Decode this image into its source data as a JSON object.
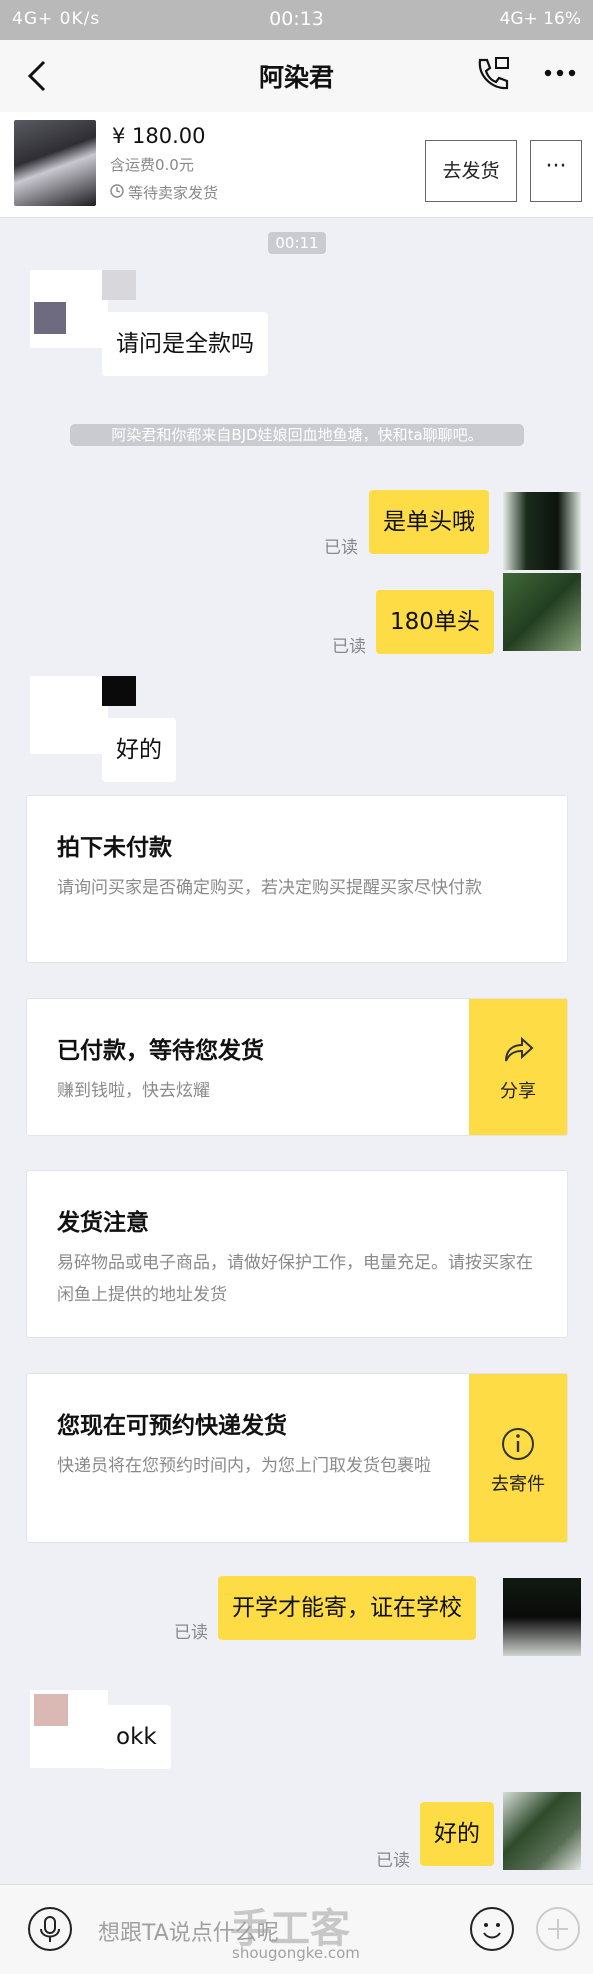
{
  "status_bar": {
    "left": "4G+ 0K/s",
    "time": "00:13",
    "right": "4G+ 16%"
  },
  "header": {
    "title": "阿染君"
  },
  "product": {
    "price": "¥ 180.00",
    "shipping": "含运费0.0元",
    "status": "等待卖家发货",
    "ship_button": "去发货",
    "more_button": "···"
  },
  "chat": {
    "timestamp": "00:11",
    "system_note": "阿染君和你都来自BJD娃娘回血地鱼塘，快和ta聊聊吧。",
    "msg1": "请问是全款吗",
    "msg2": "是单头哦",
    "msg3": "180单头",
    "msg4": "好的",
    "msg5": "开学才能寄，证在学校",
    "msg6": "okk",
    "msg7": "好的",
    "read_label": "已读"
  },
  "cards": {
    "c1": {
      "title": "拍下未付款",
      "desc": "请询问买家是否确定购买，若决定购买提醒买家尽快付款"
    },
    "c2": {
      "title": "已付款，等待您发货",
      "desc": "赚到钱啦，快去炫耀",
      "action": "分享"
    },
    "c3": {
      "title": "发货注意",
      "desc": "易碎物品或电子商品，请做好保护工作，电量充足。请按买家在闲鱼上提供的地址发货"
    },
    "c4": {
      "title": "您现在可预约快递发货",
      "desc": "快递员将在您预约时间内，为您上门取发货包裹啦",
      "action": "去寄件"
    }
  },
  "input": {
    "placeholder": "想跟TA说点什么呢"
  },
  "watermark": {
    "main": "手工客",
    "url": "shougongke.com"
  },
  "colors": {
    "accent": "#fedc46",
    "background": "#eef0f6"
  }
}
